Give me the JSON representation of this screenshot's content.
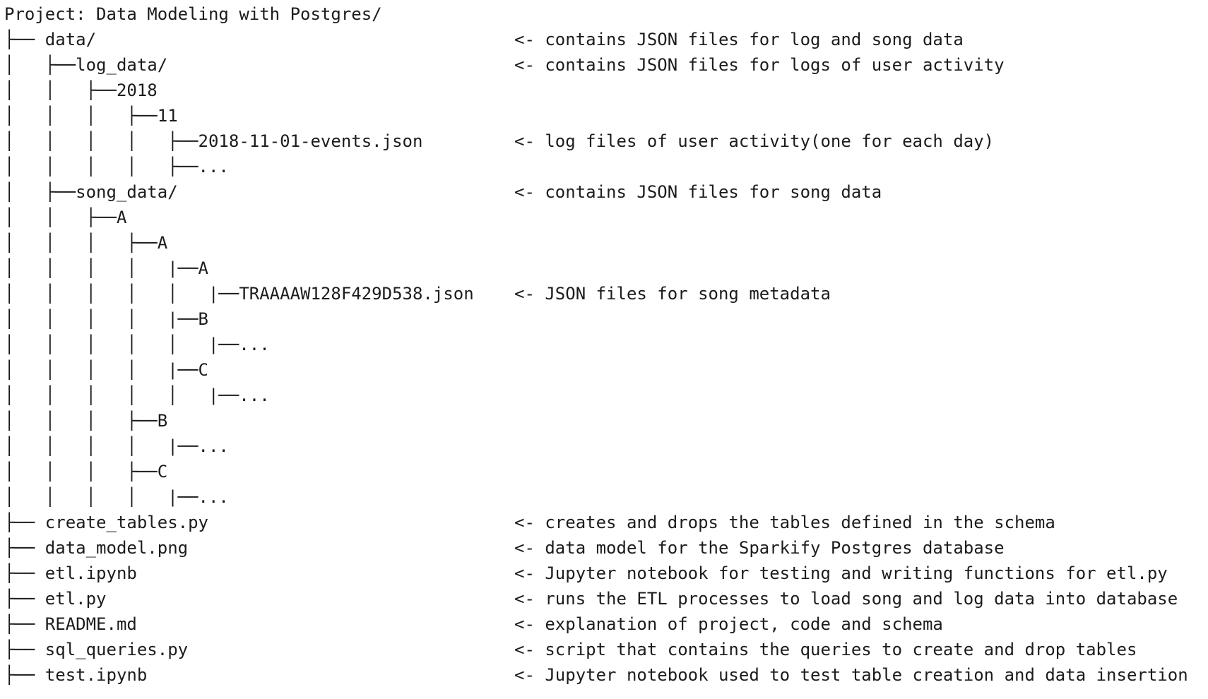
{
  "lines": [
    {
      "tree": "Project: Data Modeling with Postgres/",
      "comment": ""
    },
    {
      "tree": "├── data/",
      "comment": "<- contains JSON files for log and song data"
    },
    {
      "tree": "│   ├──log_data/",
      "comment": "<- contains JSON files for logs of user activity"
    },
    {
      "tree": "│   │   ├──2018",
      "comment": ""
    },
    {
      "tree": "│   │   │   ├──11",
      "comment": ""
    },
    {
      "tree": "│   │   │   │   ├──2018-11-01-events.json",
      "comment": "<- log files of user activity(one for each day)"
    },
    {
      "tree": "│   │   │   │   ├──...",
      "comment": ""
    },
    {
      "tree": "│   ├──song_data/",
      "comment": "<- contains JSON files for song data"
    },
    {
      "tree": "│   │   ├──A",
      "comment": ""
    },
    {
      "tree": "│   │   │   ├──A",
      "comment": ""
    },
    {
      "tree": "│   │   │   │   |──A",
      "comment": ""
    },
    {
      "tree": "│   │   │   │   │   |──TRAAAAW128F429D538.json",
      "comment": "<- JSON files for song metadata"
    },
    {
      "tree": "│   │   │   │   |──B",
      "comment": ""
    },
    {
      "tree": "│   │   │   │   │   |──...",
      "comment": ""
    },
    {
      "tree": "│   │   │   │   |──C",
      "comment": ""
    },
    {
      "tree": "│   │   │   │   │   |──...",
      "comment": ""
    },
    {
      "tree": "│   │   │   ├──B",
      "comment": ""
    },
    {
      "tree": "│   │   │   │   |──...",
      "comment": ""
    },
    {
      "tree": "│   │   │   ├──C",
      "comment": ""
    },
    {
      "tree": "│   │   │   │   |──...",
      "comment": ""
    },
    {
      "tree": "├── create_tables.py",
      "comment": "<- creates and drops the tables defined in the schema"
    },
    {
      "tree": "├── data_model.png",
      "comment": "<- data model for the Sparkify Postgres database"
    },
    {
      "tree": "├── etl.ipynb",
      "comment": "<- Jupyter notebook for testing and writing functions for etl.py"
    },
    {
      "tree": "├── etl.py",
      "comment": "<- runs the ETL processes to load song and log data into database"
    },
    {
      "tree": "├── README.md",
      "comment": "<- explanation of project, code and schema"
    },
    {
      "tree": "├── sql_queries.py",
      "comment": "<- script that contains the queries to create and drop tables"
    },
    {
      "tree": "├── test.ipynb",
      "comment": "<- Jupyter notebook used to test table creation and data insertion"
    }
  ]
}
